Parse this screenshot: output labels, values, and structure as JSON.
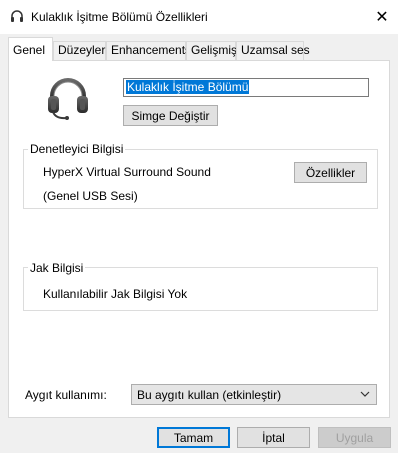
{
  "window": {
    "title": "Kulaklık İşitme Bölümü Özellikleri",
    "close_glyph": "✕"
  },
  "tabs": [
    {
      "label": "Genel",
      "active": true
    },
    {
      "label": "Düzeyler",
      "active": false
    },
    {
      "label": "Enhancements",
      "active": false
    },
    {
      "label": "Gelişmiş",
      "active": false
    },
    {
      "label": "Uzamsal ses",
      "active": false
    }
  ],
  "general": {
    "device_icon": "headset-icon",
    "name_value": "Kulaklık İşitme Bölümü",
    "change_icon_label": "Simge Değiştir"
  },
  "controller": {
    "group_title": "Denetleyici Bilgisi",
    "name": "HyperX Virtual Surround Sound",
    "sub": "(Genel USB Sesi)",
    "properties_label": "Özellikler"
  },
  "jack": {
    "group_title": "Jak Bilgisi",
    "status": "Kullanılabilir Jak Bilgisi Yok"
  },
  "device_usage": {
    "label": "Aygıt kullanımı:",
    "selected": "Bu aygıtı kullan (etkinleştir)"
  },
  "footer": {
    "ok_label": "Tamam",
    "cancel_label": "İptal",
    "apply_label": "Uygula"
  },
  "colors": {
    "accent": "#0078d7",
    "window_bg": "#f0f0f0",
    "panel_bg": "#ffffff"
  }
}
